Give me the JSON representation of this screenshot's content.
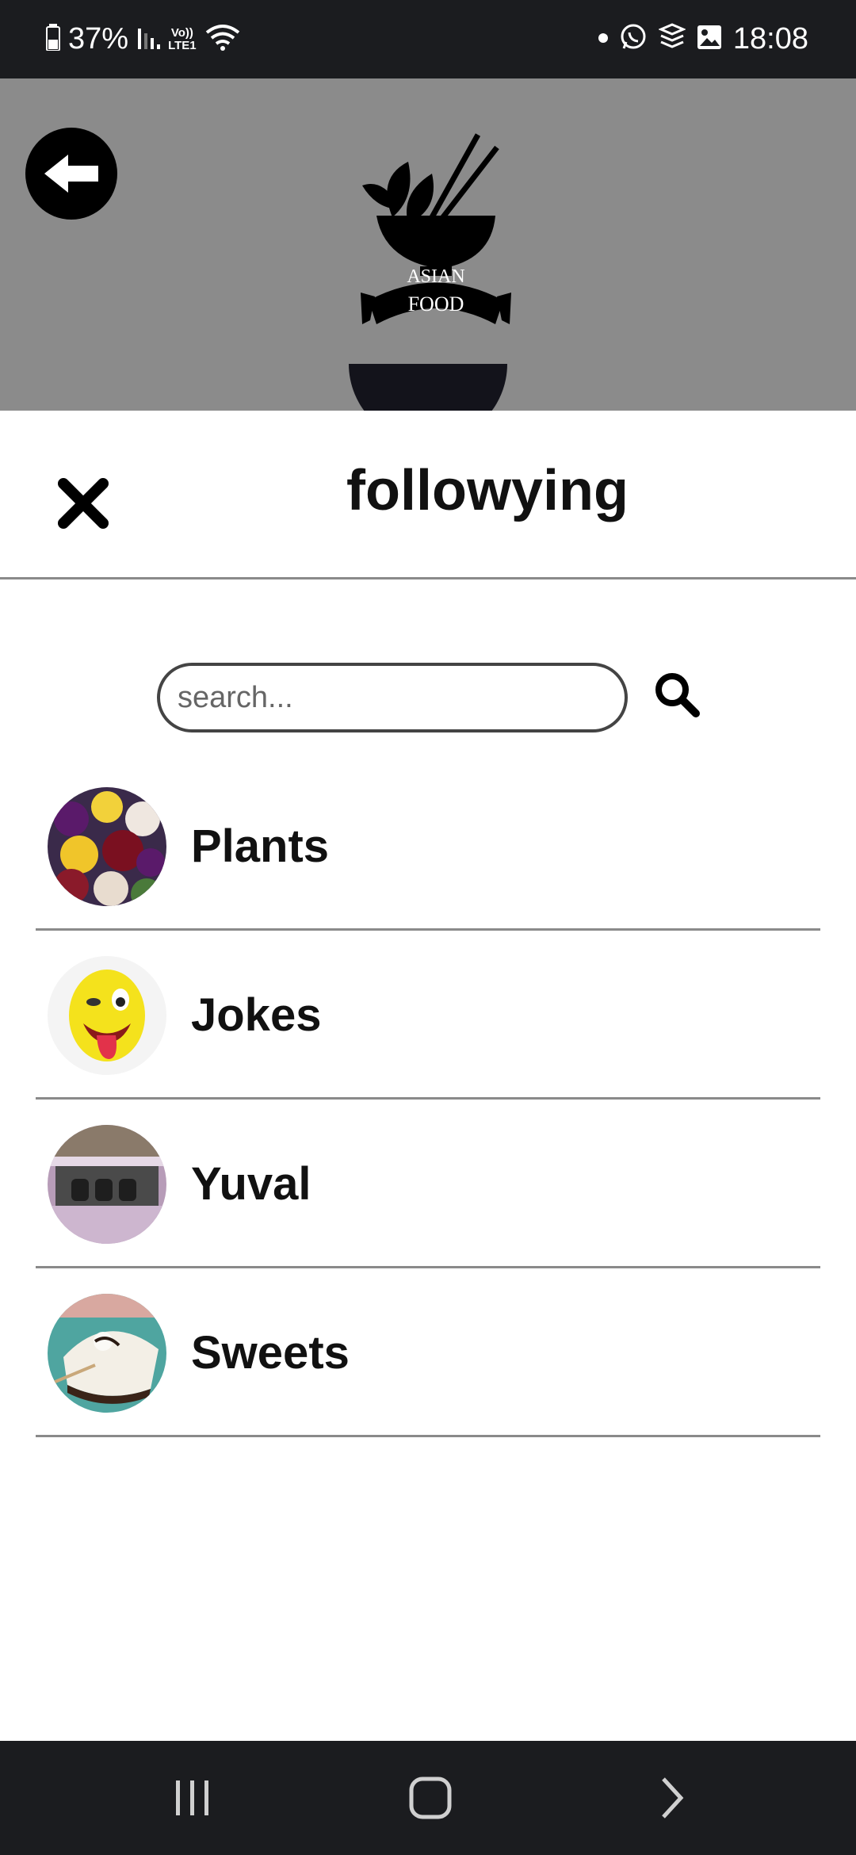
{
  "status_bar": {
    "battery": "37%",
    "network_label_top": "Vo))",
    "network_label_bottom": "LTE1",
    "time": "18:08"
  },
  "header": {
    "logo_line1": "ASIAN",
    "logo_line2": "FOOD"
  },
  "sheet": {
    "title": "followying",
    "search_placeholder": "search..."
  },
  "following": [
    {
      "name": "Plants",
      "avatar": "pansies-flowers"
    },
    {
      "name": "Jokes",
      "avatar": "winking-emoji"
    },
    {
      "name": "Yuval",
      "avatar": "shelf-photo"
    },
    {
      "name": "Sweets",
      "avatar": "cake-slice"
    }
  ],
  "colors": {
    "status_bar_bg": "#1b1c1f",
    "header_overlay": "#8b8b8b",
    "divider": "#8a8a8a",
    "text": "#111111"
  }
}
